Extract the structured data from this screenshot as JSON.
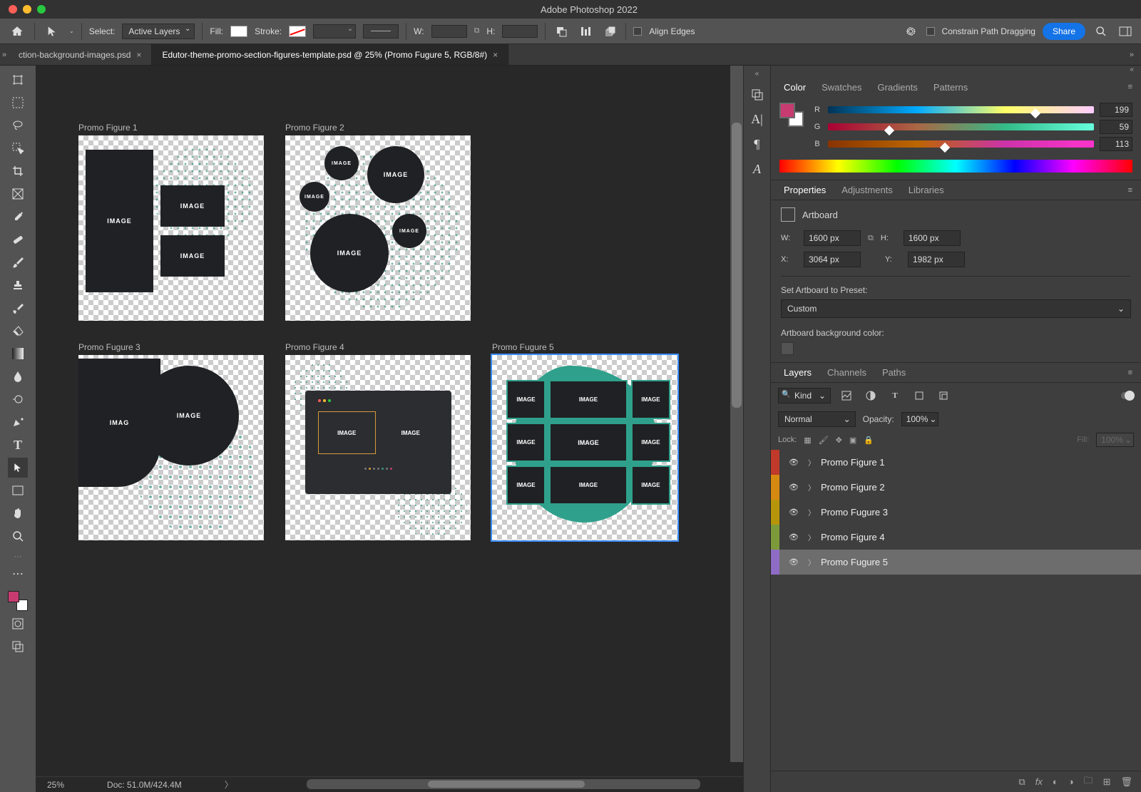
{
  "document": {
    "title": "Adobe Photoshop 2022"
  },
  "options": {
    "select_label": "Select:",
    "select_value": "Active Layers",
    "fill_label": "Fill:",
    "stroke_label": "Stroke:",
    "w_label": "W:",
    "h_label": "H:",
    "align_edges_label": "Align Edges",
    "constrain_label": "Constrain Path Dragging",
    "share_label": "Share"
  },
  "tabs": [
    {
      "name": "ction-background-images.psd",
      "active": false
    },
    {
      "name": "Edutor-theme-promo-section-figures-template.psd @ 25% (Promo Fugure 5, RGB/8#)",
      "active": true
    }
  ],
  "artboards": [
    {
      "title": "Promo Figure 1"
    },
    {
      "title": "Promo Figure 2"
    },
    {
      "title": "Promo Fugure 3"
    },
    {
      "title": "Promo Figure 4"
    },
    {
      "title": "Promo Fugure 5"
    }
  ],
  "image_label": "IMAGE",
  "image_label_short": "IMAG",
  "status": {
    "zoom": "25%",
    "doc": "Doc: 51.0M/424.4M"
  },
  "color_panel": {
    "tabs": [
      "Color",
      "Swatches",
      "Gradients",
      "Patterns"
    ],
    "channels": [
      {
        "label": "R",
        "value": "199",
        "gradient": "linear-gradient(to right,#003,#0af,#ff6,#fcf)",
        "thumb": 78
      },
      {
        "label": "G",
        "value": "59",
        "gradient": "linear-gradient(to right,#a03,#a64,#3b8,#6fd)",
        "thumb": 23
      },
      {
        "label": "B",
        "value": "113",
        "gradient": "linear-gradient(to right,#830,#b60,#c3a,#f3c)",
        "thumb": 44
      }
    ],
    "foreground": "#c73b71",
    "background": "#ffffff"
  },
  "properties_panel": {
    "tabs": [
      "Properties",
      "Adjustments",
      "Libraries"
    ],
    "type_label": "Artboard",
    "W": "1600 px",
    "H": "1600 px",
    "X": "3064 px",
    "Y": "1982 px",
    "w_label": "W:",
    "h_label": "H:",
    "x_label": "X:",
    "y_label": "Y:",
    "preset_label": "Set Artboard to Preset:",
    "preset_value": "Custom",
    "bgcolor_label": "Artboard background color:"
  },
  "layers_panel": {
    "tabs": [
      "Layers",
      "Channels",
      "Paths"
    ],
    "kind_label": "Kind",
    "blend_mode": "Normal",
    "opacity_label": "Opacity:",
    "opacity_value": "100%",
    "lock_label": "Lock:",
    "fill_label": "Fill:",
    "fill_value": "100%",
    "items": [
      {
        "name": "Promo Figure 1",
        "color": "#c0392b"
      },
      {
        "name": "Promo Figure 2",
        "color": "#d68910"
      },
      {
        "name": "Promo Fugure 3",
        "color": "#b7950b"
      },
      {
        "name": "Promo Figure 4",
        "color": "#7d9a3a"
      },
      {
        "name": "Promo Fugure 5",
        "color": "#8e6bc5",
        "selected": true
      }
    ]
  }
}
